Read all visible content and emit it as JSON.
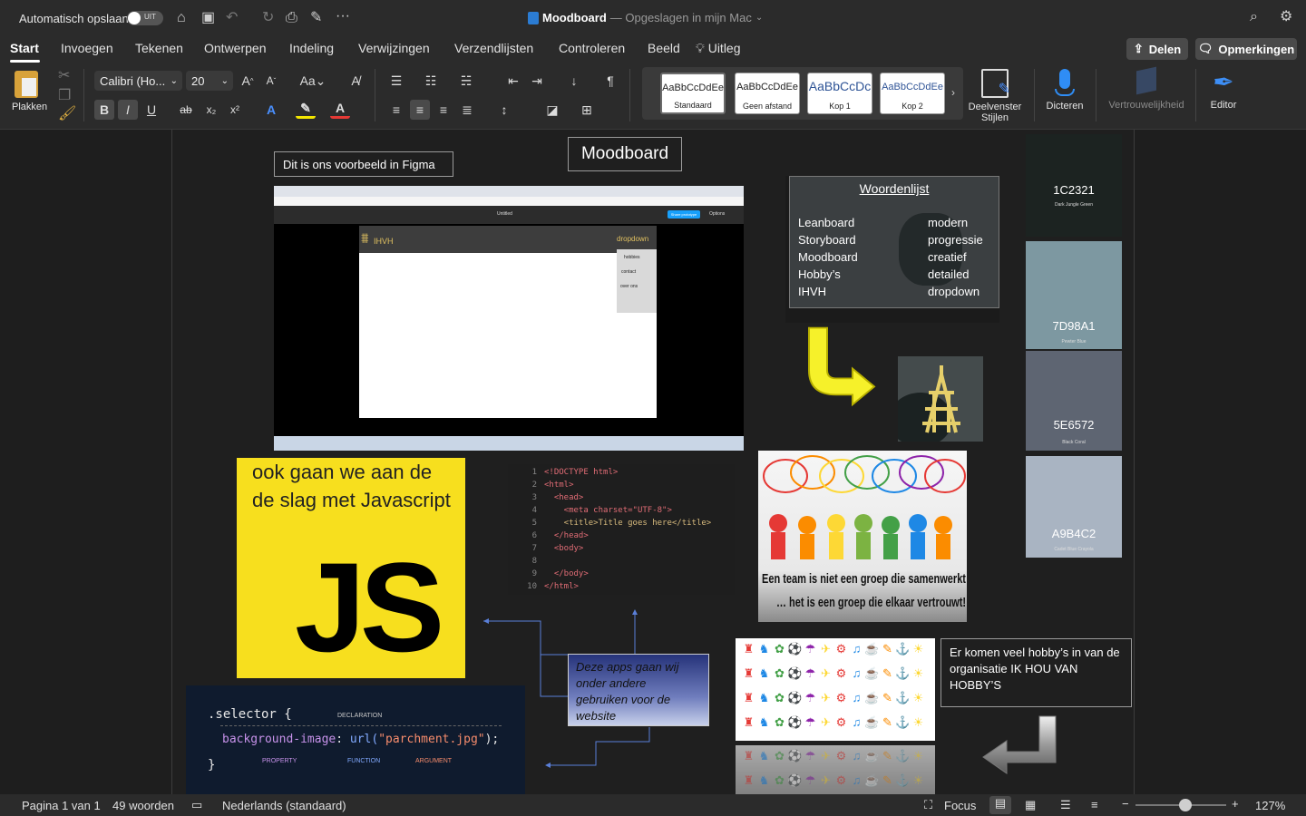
{
  "titlebar": {
    "autosave_label": "Automatisch opslaan",
    "autosave_state": "UIT",
    "doc_title": "Moodboard",
    "doc_status": "— Opgeslagen in mijn Mac"
  },
  "tabs": [
    "Start",
    "Invoegen",
    "Tekenen",
    "Ontwerpen",
    "Indeling",
    "Verwijzingen",
    "Verzendlijsten",
    "Controleren",
    "Beeld",
    "Uitleg"
  ],
  "actions": {
    "share": "Delen",
    "comments": "Opmerkingen"
  },
  "ribbon": {
    "paste_label": "Plakken",
    "font_name": "Calibri (Ho...",
    "font_size": "20",
    "styles": [
      {
        "sample": "AaBbCcDdEe",
        "name": "Standaard"
      },
      {
        "sample": "AaBbCcDdEe",
        "name": "Geen afstand"
      },
      {
        "sample": "AaBbCcDc",
        "name": "Kop 1"
      },
      {
        "sample": "AaBbCcDdEe",
        "name": "Kop 2"
      }
    ],
    "styles_pane_label": "Deelvenster Stijlen",
    "dictate_label": "Dicteren",
    "sensitivity_label": "Vertrouwelijkheid",
    "editor_label": "Editor"
  },
  "doc": {
    "moodboard_title": "Moodboard",
    "figma_caption": "Dit is ons voorbeeld in Figma",
    "figma_shot": {
      "brand": "IHVH",
      "dropdown": "dropdown",
      "menu": [
        "hobbies",
        "contact",
        "over ons"
      ],
      "tab_title": "Untitled",
      "share_btn": "Share prototype",
      "options": "Options"
    },
    "word_list": {
      "title": "Woordenlijst",
      "left": [
        "Leanboard",
        "Storyboard",
        "Moodboard",
        "Hobby’s",
        "IHVH"
      ],
      "right": [
        "modern",
        "progressie",
        "creatief",
        "detailed",
        "dropdown"
      ]
    },
    "js_box": {
      "text_line1": "ook gaan we aan de",
      "text_line2": "de slag met Javascript",
      "logo": "JS"
    },
    "code_lines": [
      {
        "n": "1",
        "code": "<!DOCTYPE html>"
      },
      {
        "n": "2",
        "code": "<html>"
      },
      {
        "n": "3",
        "code": "  <head>"
      },
      {
        "n": "4",
        "code": "    <meta charset=\"UTF-8\">"
      },
      {
        "n": "5",
        "code": "    <title>Title goes here</title>"
      },
      {
        "n": "6",
        "code": "  </head>"
      },
      {
        "n": "7",
        "code": "  <body>"
      },
      {
        "n": "8",
        "code": ""
      },
      {
        "n": "9",
        "code": "  </body>"
      },
      {
        "n": "10",
        "code": "</html>"
      }
    ],
    "css_snippet": {
      "selector": ".selector {",
      "declaration_label": "DECLARATION",
      "property": "background-image",
      "func": "url(",
      "arg": "\"parchment.jpg\"",
      "close": ");",
      "brace_close": "}",
      "property_label": "PROPERTY",
      "function_label": "FUNCTION",
      "argument_label": "ARGUMENT"
    },
    "apps_note": "Deze apps gaan wij onder andere gebruiken voor de website",
    "team_quote_1": "Een team is niet een groep die samenwerkt ….",
    "team_quote_2": "… het is een groep die elkaar vertrouwt!",
    "hobby_note": "Er komen veel hobby’s in van de organisatie IK HOU VAN HOBBY’S",
    "swatches": [
      {
        "hex": "1C2321",
        "name": "Dark Jungle Green",
        "color": "#1c2321"
      },
      {
        "hex": "7D98A1",
        "name": "Pewter Blue",
        "color": "#7d98a1"
      },
      {
        "hex": "5E6572",
        "name": "Black Coral",
        "color": "#5e6572"
      },
      {
        "hex": "A9B4C2",
        "name": "Cadet Blue Crayola",
        "color": "#a9b4c2"
      }
    ]
  },
  "status": {
    "page": "Pagina 1 van 1",
    "words": "49 woorden",
    "language": "Nederlands (standaard)",
    "focus": "Focus",
    "zoom": "127%",
    "zoom_level": 0.55
  }
}
